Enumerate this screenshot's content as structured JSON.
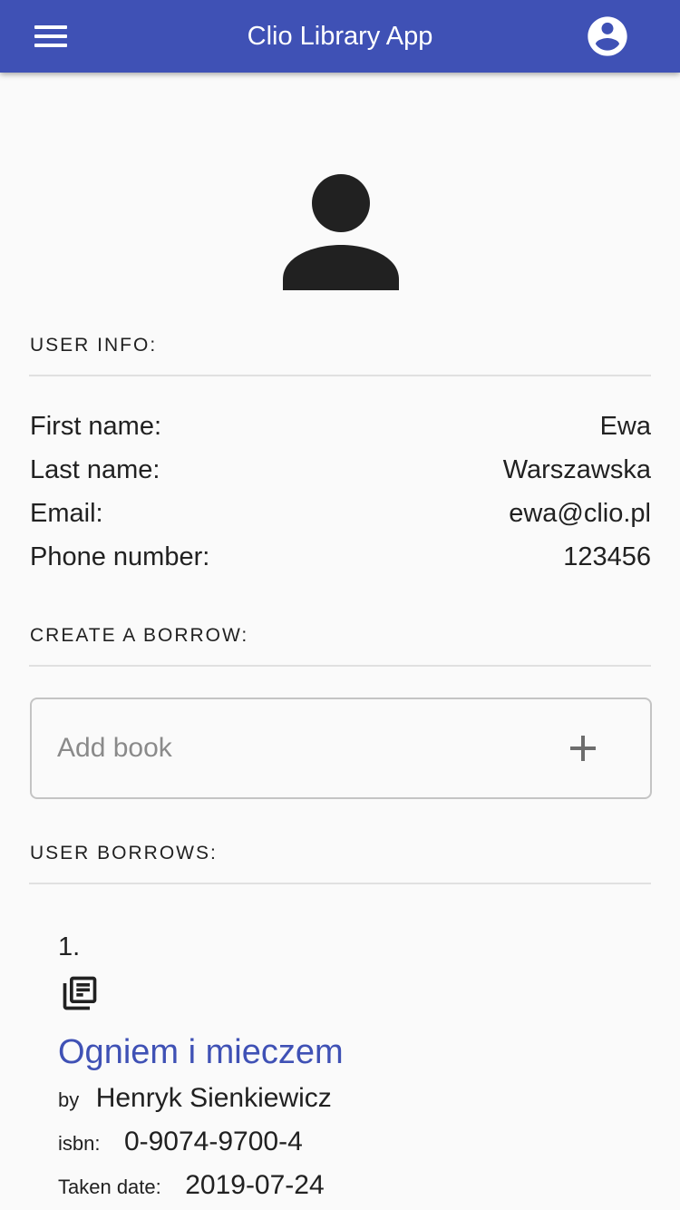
{
  "appbar": {
    "title": "Clio Library App",
    "menu_icon": "menu-icon",
    "account_icon": "account-circle-icon",
    "color": "#3f51b5"
  },
  "profile": {
    "avatar_icon": "person-icon"
  },
  "user_info": {
    "header": "USER INFO:",
    "rows": [
      {
        "label": "First name:",
        "value": "Ewa"
      },
      {
        "label": "Last name:",
        "value": "Warszawska"
      },
      {
        "label": "Email:",
        "value": "ewa@clio.pl"
      },
      {
        "label": "Phone number:",
        "value": "123456"
      }
    ]
  },
  "create_borrow": {
    "header": "CREATE A BORROW:",
    "input_placeholder": "Add book",
    "input_value": "",
    "add_icon": "plus-icon"
  },
  "user_borrows": {
    "header": "USER BORROWS:",
    "items": [
      {
        "index": "1.",
        "icon": "library-books-icon",
        "title": "Ogniem i mieczem",
        "by_label": "by",
        "author": "Henryk Sienkiewicz",
        "isbn_label": "isbn:",
        "isbn": "0-9074-9700-4",
        "taken_label": "Taken date:",
        "taken_date": "2019-07-24"
      }
    ]
  }
}
